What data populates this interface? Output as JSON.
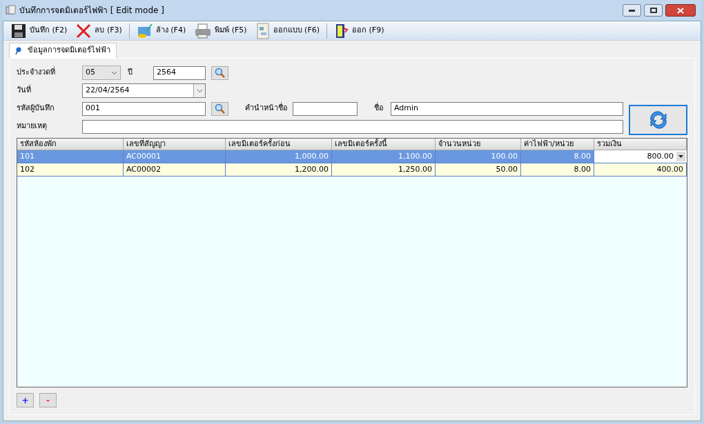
{
  "window": {
    "title": "บันทึกการจดมิเตอร์ไฟฟ้า [ Edit mode ]"
  },
  "toolbar": [
    {
      "kind": "save",
      "label": "บันทึก (F2)"
    },
    {
      "kind": "delete",
      "label": "ลบ (F3)"
    },
    {
      "kind": "clear",
      "label": "ล้าง (F4)"
    },
    {
      "kind": "print",
      "label": "พิมพ์ (F5)"
    },
    {
      "kind": "design",
      "label": "ออกแบบ (F6)"
    },
    {
      "kind": "exit",
      "label": "ออก (F9)"
    }
  ],
  "tabs": [
    {
      "label": "ข้อมูลการจดมิเตอร์ไฟฟ้า",
      "selected": true
    }
  ],
  "form": {
    "period_label": "ประจำงวดที่",
    "period": "05",
    "year_label": "ปี",
    "year": "2564",
    "date_label": "วันที่",
    "date": "22/04/2564",
    "recorder_label": "รหัสผู้บันทึก",
    "recorder": "001",
    "prefix_label": "คำนำหน้าชื่อ",
    "name_label": "ชื่อ",
    "name": "Admin",
    "note_label": "หมายเหตุ"
  },
  "table": {
    "columns": [
      "รหัสห้องพัก",
      "เลขที่สัญญา",
      "เลขมิเตอร์ครั้งก่อน",
      "เลขมิเตอร์ครั้งนี้",
      "จำนวนหน่วย",
      "ค่าไฟฟ้า/หน่วย",
      "รวมเงิน"
    ],
    "rows": [
      {
        "selected": true,
        "editing": true,
        "cells": [
          "101",
          "AC00001",
          "1,000.00",
          "1,100.00",
          "100.00",
          "8.00",
          "800.00"
        ]
      },
      {
        "selected": false,
        "editing": false,
        "cells": [
          "102",
          "AC00002",
          "1,200.00",
          "1,250.00",
          "50.00",
          "8.00",
          "400.00"
        ]
      }
    ]
  },
  "row_buttons": [
    "+",
    "-"
  ]
}
